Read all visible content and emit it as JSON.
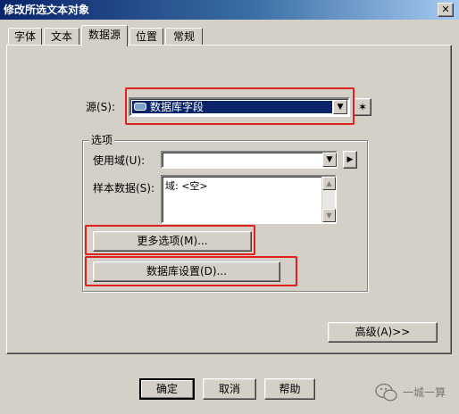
{
  "window": {
    "title": "修改所选文本对象",
    "close_glyph": "✕"
  },
  "tabs": [
    {
      "label": "字体"
    },
    {
      "label": "文本"
    },
    {
      "label": "数据源",
      "active": true
    },
    {
      "label": "位置"
    },
    {
      "label": "常规"
    }
  ],
  "source": {
    "label": "源(S):",
    "value": "数据库字段"
  },
  "options_group": {
    "title": "选项",
    "use_field_label": "使用域(U):",
    "use_field_value": "",
    "sample_label": "样本数据(S):",
    "sample_text": "域: <空>",
    "more_options_label": "更多选项(M)...",
    "db_settings_label": "数据库设置(D)..."
  },
  "advanced_label": "高级(A)>>",
  "footer": {
    "ok": "确定",
    "cancel": "取消",
    "help": "帮助"
  },
  "watermark": {
    "text": "一城一算"
  },
  "colors": {
    "title_start": "#0a246a",
    "selection": "#0a246a",
    "highlight_box": "#e0201c",
    "face": "#d4d0c8"
  }
}
